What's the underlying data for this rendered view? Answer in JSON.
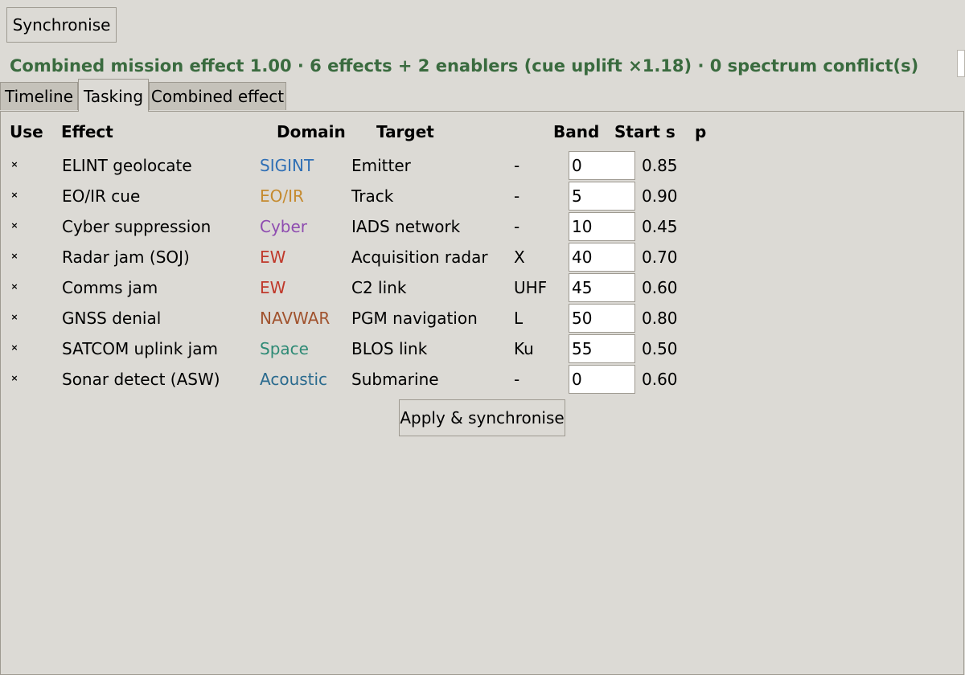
{
  "toolbar": {
    "synchronise_label": "Synchronise"
  },
  "status": {
    "text": "Combined mission effect 1.00  ·  6 effects + 2 enablers (cue uplift ×1.18)  ·  0 spectrum conflict(s)",
    "color": "#3a6b3f"
  },
  "tabs": [
    {
      "label": "Timeline",
      "active": false
    },
    {
      "label": "Tasking",
      "active": true
    },
    {
      "label": "Combined effect",
      "active": false
    }
  ],
  "table": {
    "headers": {
      "use": "Use",
      "effect": "Effect",
      "domain": "Domain",
      "target": "Target",
      "band": "Band",
      "start": "Start s",
      "p": "p"
    },
    "rows": [
      {
        "checked": true,
        "effect": "ELINT geolocate",
        "domain": "SIGINT",
        "domain_color": "#2f6fb5",
        "target": "Emitter",
        "band": "-",
        "start": "0",
        "p": "0.85"
      },
      {
        "checked": true,
        "effect": "EO/IR cue",
        "domain": "EO/IR",
        "domain_color": "#c58a2e",
        "target": "Track",
        "band": "-",
        "start": "5",
        "p": "0.90"
      },
      {
        "checked": true,
        "effect": "Cyber suppression",
        "domain": "Cyber",
        "domain_color": "#8e4cb0",
        "target": "IADS network",
        "band": "-",
        "start": "10",
        "p": "0.45"
      },
      {
        "checked": true,
        "effect": "Radar jam (SOJ)",
        "domain": "EW",
        "domain_color": "#c0392b",
        "target": "Acquisition radar",
        "band": "X",
        "start": "40",
        "p": "0.70"
      },
      {
        "checked": true,
        "effect": "Comms jam",
        "domain": "EW",
        "domain_color": "#c0392b",
        "target": "C2 link",
        "band": "UHF",
        "start": "45",
        "p": "0.60"
      },
      {
        "checked": true,
        "effect": "GNSS denial",
        "domain": "NAVWAR",
        "domain_color": "#a0522d",
        "target": "PGM navigation",
        "band": "L",
        "start": "50",
        "p": "0.80"
      },
      {
        "checked": true,
        "effect": "SATCOM uplink jam",
        "domain": "Space",
        "domain_color": "#2e8a75",
        "target": "BLOS link",
        "band": "Ku",
        "start": "55",
        "p": "0.50"
      },
      {
        "checked": true,
        "effect": "Sonar detect (ASW)",
        "domain": "Acoustic",
        "domain_color": "#2a6a8e",
        "target": "Submarine",
        "band": "-",
        "start": "0",
        "p": "0.60"
      }
    ]
  },
  "apply_label": "Apply & synchronise",
  "icons": {
    "checkbox_checked": "checkbox-checked-icon"
  }
}
